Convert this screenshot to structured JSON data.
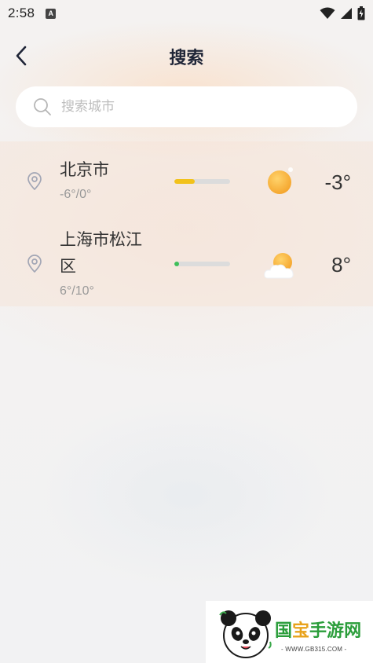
{
  "status_bar": {
    "time": "2:58",
    "app_icon_letter": "A",
    "icons": [
      "wifi-icon",
      "signal-icon",
      "battery-icon"
    ]
  },
  "header": {
    "title": "搜索",
    "back_icon": "chevron-left-icon"
  },
  "search": {
    "placeholder": "搜索城市",
    "value": "",
    "icon": "search-icon"
  },
  "cities": [
    {
      "name": "北京市",
      "range": "-6°/0°",
      "temp": "-3°",
      "weather_icon": "sunny-icon",
      "bar_fill_fraction": 0.37,
      "bar_color": "#f2c21b"
    },
    {
      "name": "上海市松江区",
      "range": "6°/10°",
      "temp": "8°",
      "weather_icon": "partly-cloudy-icon",
      "bar_fill_fraction": 0.08,
      "bar_color": "#3fbf5a"
    }
  ],
  "watermark": {
    "brand": "国宝手游网",
    "url": "- WWW.GB315.COM -"
  }
}
